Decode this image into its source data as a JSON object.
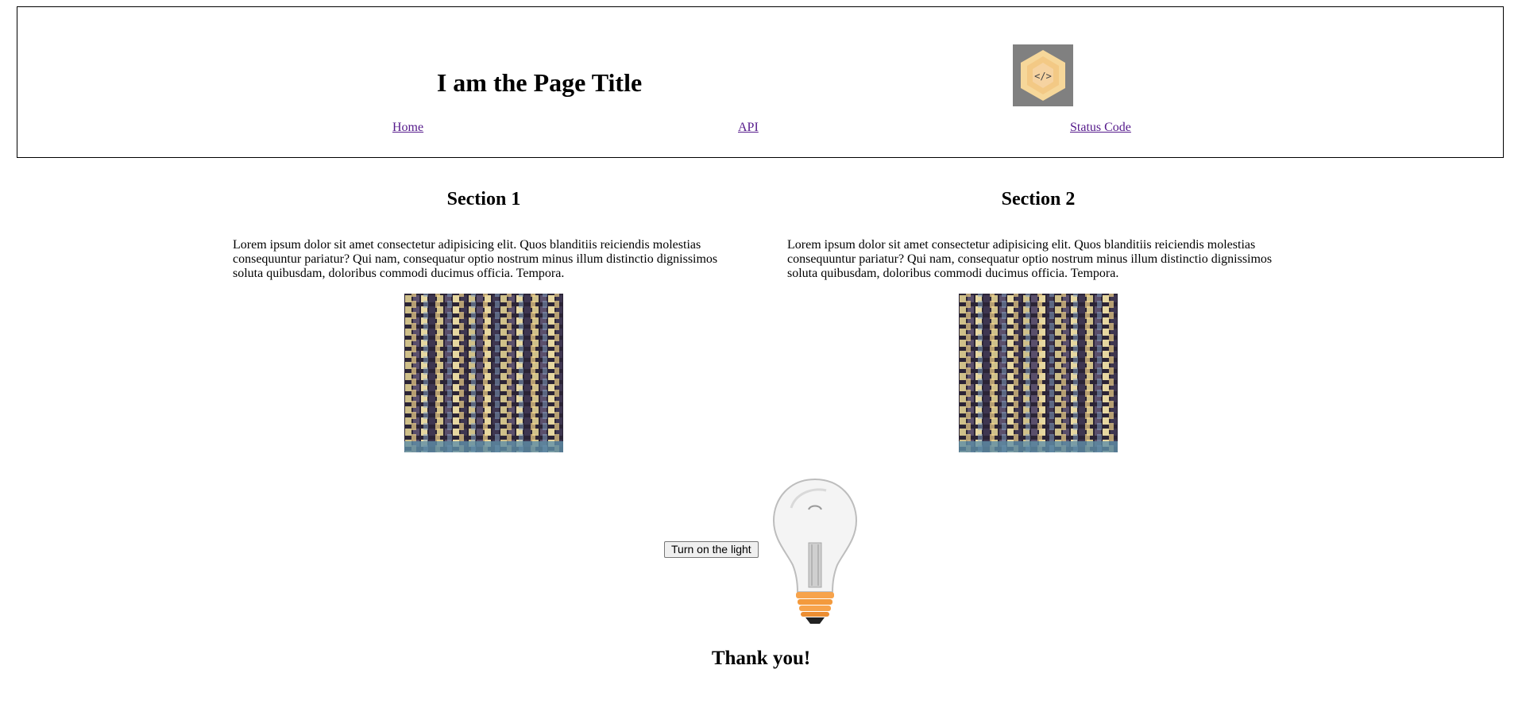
{
  "header": {
    "title": "I am the Page Title",
    "logo_icon": "code-hexagon-logo",
    "logo_glyph": "</>",
    "nav": [
      {
        "label": "Home"
      },
      {
        "label": "API"
      },
      {
        "label": "Status Code"
      }
    ]
  },
  "sections": [
    {
      "title": "Section 1",
      "text": "Lorem ipsum dolor sit amet consectetur adipisicing elit. Quos blanditiis reiciendis molestias consequuntur pariatur? Qui nam, consequatur optio nostrum minus illum distinctio dignissimos soluta quibusdam, doloribus commodi ducimus officia. Tempora.",
      "image": "night-building-windows"
    },
    {
      "title": "Section 2",
      "text": "Lorem ipsum dolor sit amet consectetur adipisicing elit. Quos blanditiis reiciendis molestias consequuntur pariatur? Qui nam, consequatur optio nostrum minus illum distinctio dignissimos soluta quibusdam, doloribus commodi ducimus officia. Tempora.",
      "image": "night-building-windows"
    }
  ],
  "light": {
    "button_label": "Turn on the light",
    "state": "off",
    "icon": "lightbulb-icon"
  },
  "footer": {
    "thanks": "Thank you!"
  },
  "colors": {
    "link": "#551a8b",
    "logo_background": "#808080",
    "bulb_base": "#f7a34b"
  }
}
